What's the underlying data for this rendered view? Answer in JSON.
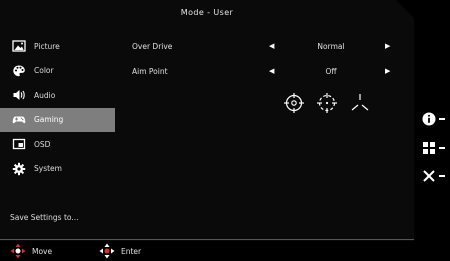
{
  "title": "Mode - User",
  "sidebar": {
    "items": [
      {
        "label": "Picture",
        "icon": "picture-icon"
      },
      {
        "label": "Color",
        "icon": "palette-icon"
      },
      {
        "label": "Audio",
        "icon": "speaker-icon"
      },
      {
        "label": "Gaming",
        "icon": "gamepad-icon",
        "active": true
      },
      {
        "label": "OSD",
        "icon": "osd-icon"
      },
      {
        "label": "System",
        "icon": "gear-icon"
      }
    ]
  },
  "settings": [
    {
      "label": "Over Drive",
      "value": "Normal"
    },
    {
      "label": "Aim Point",
      "value": "Off"
    }
  ],
  "aim_point_options": [
    "crosshair-circle-icon",
    "crosshair-dashed-icon",
    "crosshair-tripod-icon"
  ],
  "save_settings": "Save Settings to...",
  "footer": {
    "move_label": "Move",
    "enter_label": "Enter"
  },
  "colors": {
    "accent": "#d32f2f",
    "active_bg": "#7e7e7e",
    "panel_bg": "#0a0a0a"
  }
}
